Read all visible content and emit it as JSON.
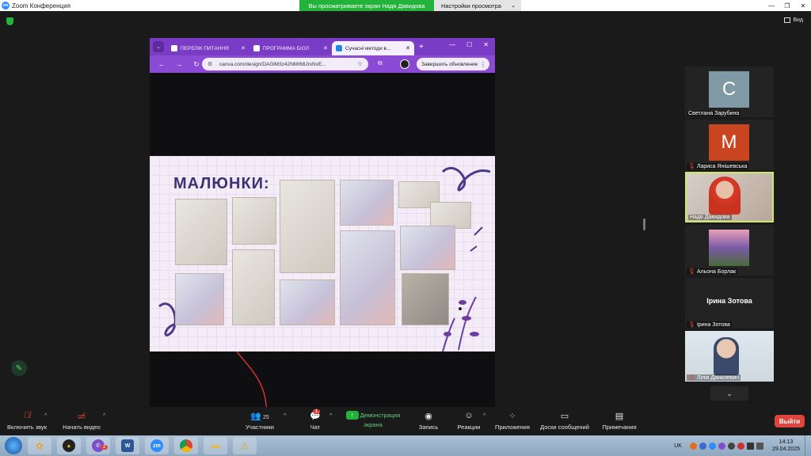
{
  "window": {
    "title": "Zoom Конференция",
    "logo": "zm"
  },
  "banner": {
    "sharing_text": "Вы просматриваете экран Надя Давидова",
    "view_settings": "Настройки просмотра"
  },
  "view_label": "Вид",
  "browser": {
    "tabs": [
      {
        "label": "ПЕРЕЛІК ПИТАННЯ"
      },
      {
        "label": "ПРОГРАММА БІОЛ"
      },
      {
        "label": "Сучасні методи в..."
      }
    ],
    "url": "canva.com/design/DAGlM3z42NM/68JrxNvE...",
    "update_button": "Завершить обновление"
  },
  "slide": {
    "title": "МАЛЮНКИ:"
  },
  "participants": [
    {
      "name": "Светлана Зарубина",
      "initial": "С",
      "color": "#7f9aa5",
      "muted": false
    },
    {
      "name": "Лариса Янішевська",
      "initial": "M",
      "color": "#c8451f",
      "muted": true
    },
    {
      "name": "Надя Давидова",
      "muted": false,
      "active": true
    },
    {
      "name": "Альона Борлак",
      "muted": true
    },
    {
      "name": "Ірина Зотова",
      "display_name": "Ірина Зотова",
      "muted": true
    },
    {
      "name": "Лілія Данилевич",
      "muted": true
    }
  ],
  "toolbar": {
    "audio": "Включить звук",
    "video": "Начать видео",
    "participants": "Участники",
    "participants_count": "25",
    "chat": "Чат",
    "chat_badge": "1",
    "share": "Демонстрация экрана",
    "record": "Запись",
    "reactions": "Реакции",
    "apps": "Приложения",
    "whiteboards": "Доски сообщений",
    "notes": "Примечания",
    "leave": "Выйти"
  },
  "taskbar": {
    "lang": "UK",
    "time": "14:13",
    "date": "29.04.2025",
    "viber_badge": "2",
    "zoom_label": "zm"
  }
}
